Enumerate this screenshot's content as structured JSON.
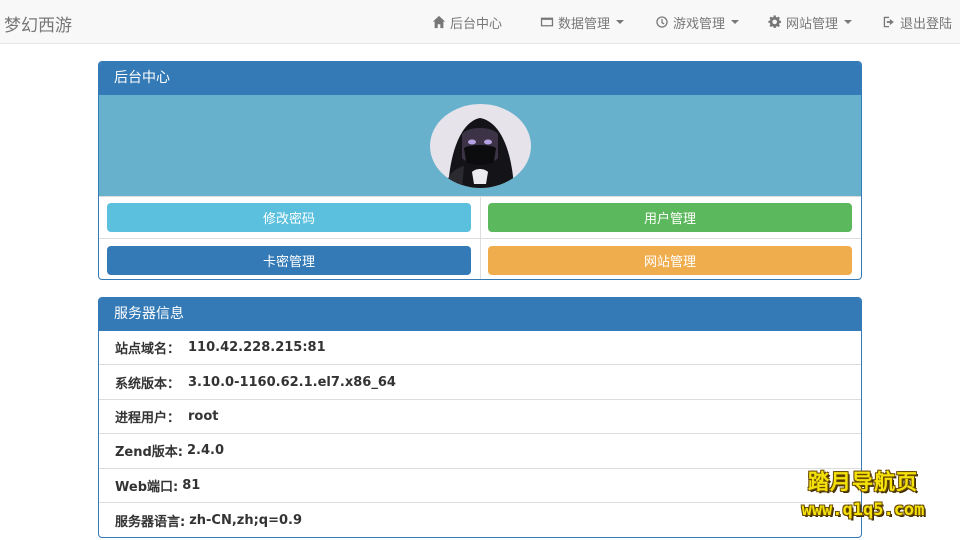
{
  "navbar": {
    "brand": "梦幻西游",
    "items": [
      {
        "label": "后台中心",
        "icon": "home-icon",
        "dropdown": false
      },
      {
        "label": "数据管理",
        "icon": "table-icon",
        "dropdown": true
      },
      {
        "label": "游戏管理",
        "icon": "clock-icon",
        "dropdown": true
      },
      {
        "label": "网站管理",
        "icon": "gear-icon",
        "dropdown": true
      },
      {
        "label": "退出登陆",
        "icon": "logout-icon",
        "dropdown": false
      }
    ]
  },
  "admin_panel": {
    "title": "后台中心",
    "buttons": [
      {
        "label": "修改密码",
        "color": "#5bc0de"
      },
      {
        "label": "用户管理",
        "color": "#5cb85c"
      },
      {
        "label": "卡密管理",
        "color": "#337ab7"
      },
      {
        "label": "网站管理",
        "color": "#f0ad4e"
      }
    ]
  },
  "server_panel": {
    "title": "服务器信息",
    "rows": [
      {
        "label": "站点域名：",
        "value": "110.42.228.215:81"
      },
      {
        "label": "系统版本：",
        "value": "3.10.0-1160.62.1.el7.x86_64"
      },
      {
        "label": "进程用户：",
        "value": "root"
      },
      {
        "label": "Zend版本:",
        "value": "2.4.0"
      },
      {
        "label": "Web端口:",
        "value": "81"
      },
      {
        "label": "服务器语言:",
        "value": "zh-CN,zh;q=0.9"
      }
    ]
  },
  "watermark": {
    "line1": "踏月导航页",
    "line2": "www.q1q5.com"
  },
  "colors": {
    "primary": "#337ab7",
    "info": "#5bc0de",
    "success": "#5cb85c",
    "warning": "#f0ad4e",
    "avatar_bg": "#67b1cd"
  }
}
